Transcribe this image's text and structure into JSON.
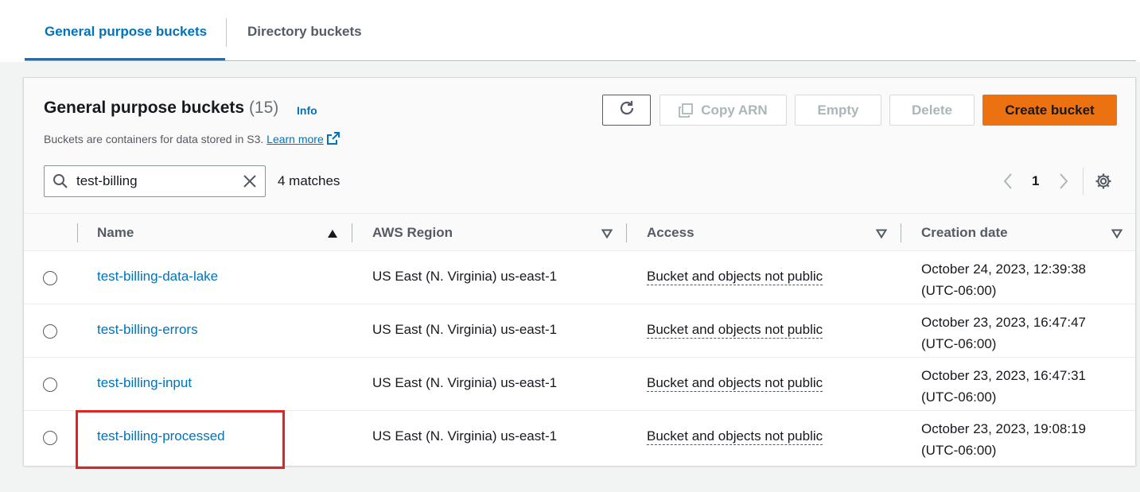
{
  "tabs": [
    {
      "label": "General purpose buckets"
    },
    {
      "label": "Directory buckets"
    }
  ],
  "panel": {
    "title": "General purpose buckets",
    "count": "(15)",
    "info_label": "Info",
    "description": "Buckets are containers for data stored in S3.",
    "learn_more": "Learn more"
  },
  "actions": {
    "copy_arn": "Copy ARN",
    "empty": "Empty",
    "delete": "Delete",
    "create_bucket": "Create bucket"
  },
  "search": {
    "value": "test-billing",
    "matches": "4 matches"
  },
  "pagination": {
    "current_page": "1"
  },
  "table": {
    "columns": [
      {
        "label": "Name",
        "sort": "ascending"
      },
      {
        "label": "AWS Region",
        "sort": "none"
      },
      {
        "label": "Access",
        "sort": "none"
      },
      {
        "label": "Creation date",
        "sort": "none"
      }
    ],
    "rows": [
      {
        "name": "test-billing-data-lake",
        "region": "US East (N. Virginia) us-east-1",
        "access": "Bucket and objects not public",
        "date": "October 24, 2023, 12:39:38",
        "tz": "(UTC-06:00)"
      },
      {
        "name": "test-billing-errors",
        "region": "US East (N. Virginia) us-east-1",
        "access": "Bucket and objects not public",
        "date": "October 23, 2023, 16:47:47",
        "tz": "(UTC-06:00)"
      },
      {
        "name": "test-billing-input",
        "region": "US East (N. Virginia) us-east-1",
        "access": "Bucket and objects not public",
        "date": "October 23, 2023, 16:47:31",
        "tz": "(UTC-06:00)"
      },
      {
        "name": "test-billing-processed",
        "region": "US East (N. Virginia) us-east-1",
        "access": "Bucket and objects not public",
        "date": "October 23, 2023, 19:08:19",
        "tz": "(UTC-06:00)"
      }
    ]
  },
  "colors": {
    "accent": "#0073bb",
    "primary_button": "#ec7211",
    "highlight": "#e02424"
  }
}
